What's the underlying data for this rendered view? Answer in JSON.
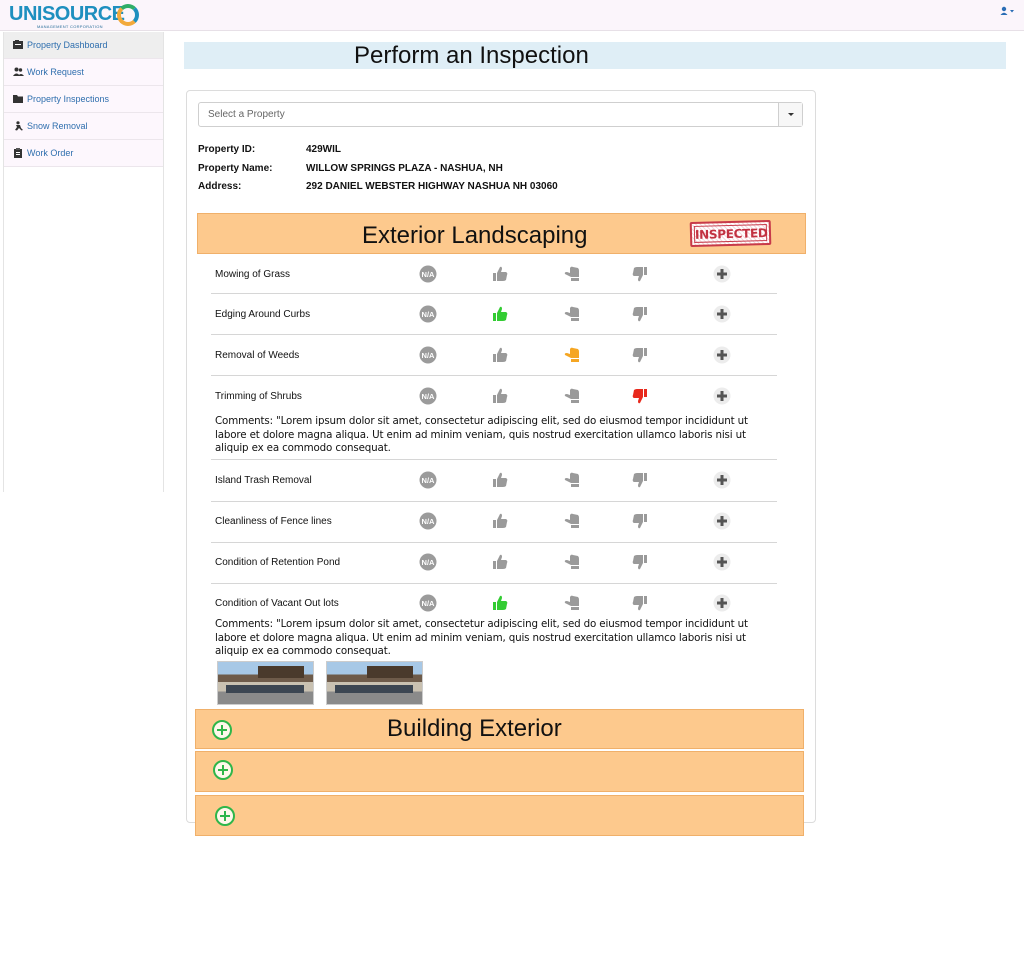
{
  "brand": {
    "name_part1": "UNI",
    "name_part2": "SOURCE",
    "tagline": "MANAGEMENT CORPORATION"
  },
  "sidebar": {
    "items": [
      {
        "label": "Property Dashboard",
        "icon": "dashboard-icon",
        "active": true
      },
      {
        "label": "Work Request",
        "icon": "users-icon"
      },
      {
        "label": "Property Inspections",
        "icon": "folder-icon"
      },
      {
        "label": "Snow Removal",
        "icon": "snow-worker-icon"
      },
      {
        "label": "Work Order",
        "icon": "clipboard-icon"
      }
    ]
  },
  "page": {
    "title": "Perform an Inspection"
  },
  "property_select": {
    "placeholder": "Select a Property"
  },
  "property": {
    "id_label": "Property ID:",
    "id_value": "429WIL",
    "name_label": "Property Name:",
    "name_value": "WILLOW SPRINGS PLAZA - NASHUA, NH",
    "address_label": "Address:",
    "address_value": "292 DANIEL WEBSTER HIGHWAY NASHUA NH 03060"
  },
  "sections": [
    {
      "title": "Exterior Landscaping",
      "stamp": "INSPECTED",
      "items": [
        {
          "label": "Mowing of Grass",
          "rating": "none"
        },
        {
          "label": "Edging Around Curbs",
          "rating": "good"
        },
        {
          "label": "Removal of Weeds",
          "rating": "fair"
        },
        {
          "label": "Trimming of Shrubs",
          "rating": "poor",
          "comment": "Comments: \"Lorem ipsum dolor sit amet, consectetur adipiscing elit, sed do eiusmod tempor incididunt ut labore et dolore magna aliqua. Ut enim ad minim veniam, quis nostrud exercitation ullamco laboris nisi ut aliquip ex ea commodo consequat."
        },
        {
          "label": "Island Trash Removal",
          "rating": "none"
        },
        {
          "label": "Cleanliness of Fence lines",
          "rating": "none"
        },
        {
          "label": "Condition of Retention Pond",
          "rating": "none"
        },
        {
          "label": "Condition of Vacant Out lots",
          "rating": "good",
          "comment": "Comments: \"Lorem ipsum dolor sit amet, consectetur adipiscing elit, sed do eiusmod tempor incididunt ut labore et dolore magna aliqua. Ut enim ad minim veniam, quis nostrud exercitation ullamco laboris nisi ut aliquip ex ea commodo consequat.",
          "photos": 2
        }
      ]
    },
    {
      "title": "Building Exterior",
      "collapsed": true
    },
    {
      "title": "",
      "collapsed": true
    },
    {
      "title": "",
      "collapsed": true
    }
  ],
  "rating_buttons": [
    "N/A",
    "thumbs-up-icon",
    "thumbs-sideways-icon",
    "thumbs-down-icon",
    "add-comment-icon"
  ],
  "colors": {
    "good": "#33cc33",
    "fair": "#f5a623",
    "poor": "#e8291c",
    "idle": "#9a9a9a",
    "section": "#fdc98d",
    "title_bar": "#dfeef6"
  }
}
